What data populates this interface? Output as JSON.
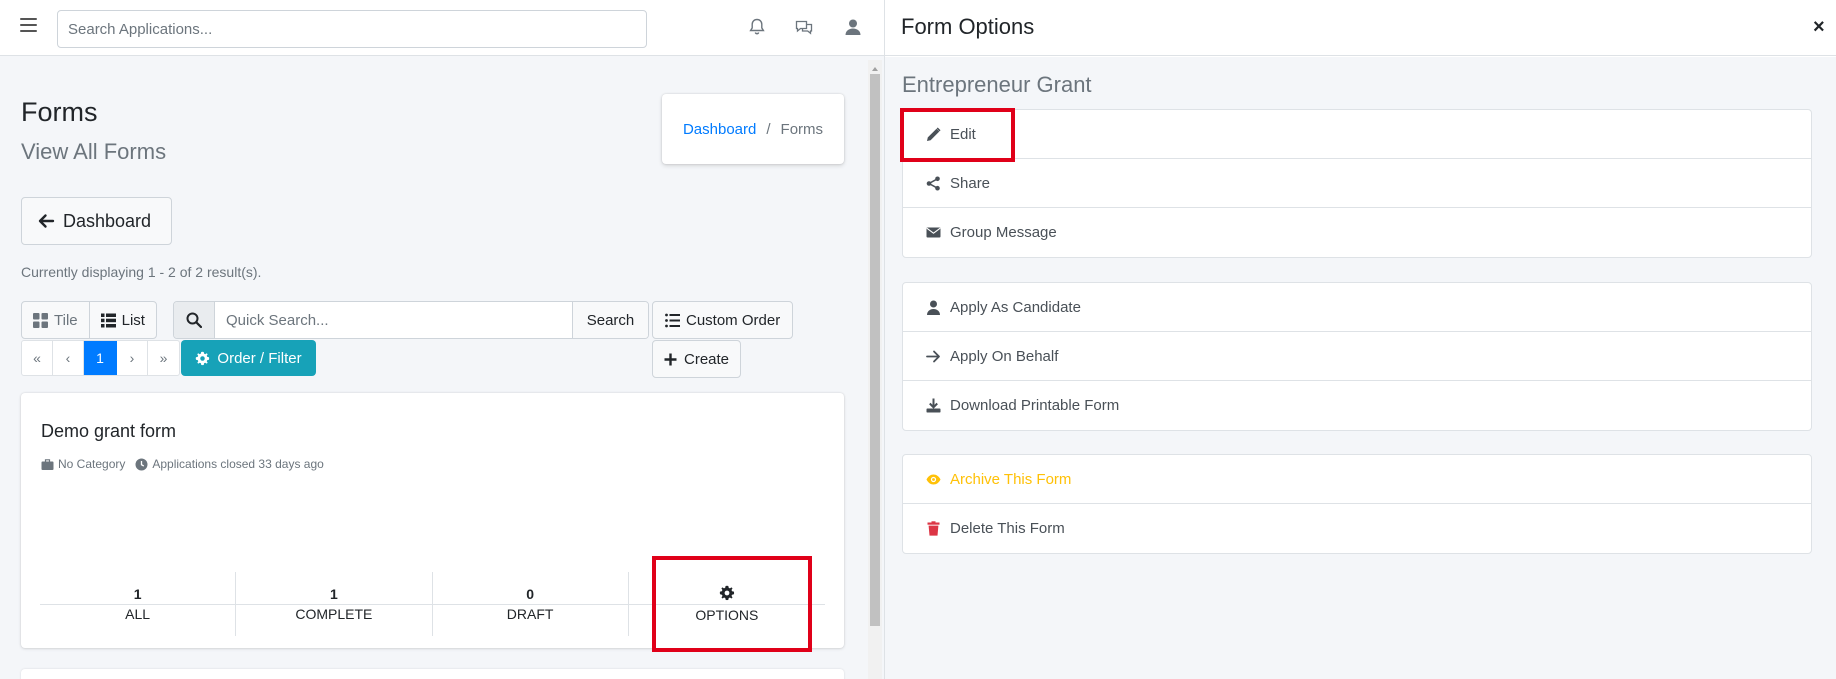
{
  "topbar": {
    "search_placeholder": "Search Applications..."
  },
  "page": {
    "title": "Forms",
    "subtitle": "View All Forms",
    "breadcrumb": {
      "link": "Dashboard",
      "separator": "/",
      "current": "Forms"
    },
    "back_button": "Dashboard",
    "result_text": "Currently displaying 1 - 2 of 2 result(s).",
    "view_toggle": {
      "tile": "Tile",
      "list": "List"
    },
    "quick_search": {
      "placeholder": "Quick Search...",
      "button": "Search"
    },
    "custom_order": "Custom Order",
    "create": "Create",
    "pagination": [
      "«",
      "‹",
      "1",
      "›",
      "»"
    ],
    "order_filter": "Order / Filter"
  },
  "form_card": {
    "title": "Demo grant form",
    "category": "No Category",
    "status": "Applications closed 33 days ago",
    "stats": [
      {
        "num": "1",
        "label": "ALL"
      },
      {
        "num": "1",
        "label": "COMPLETE"
      },
      {
        "num": "0",
        "label": "DRAFT"
      }
    ],
    "options_label": "OPTIONS"
  },
  "panel": {
    "title": "Form Options",
    "close": "×",
    "form_name": "Entrepreneur Grant",
    "group1": [
      "Edit",
      "Share",
      "Group Message"
    ],
    "group2": [
      "Apply As Candidate",
      "Apply On Behalf",
      "Download Printable Form"
    ],
    "group3": [
      "Archive This Form",
      "Delete This Form"
    ]
  },
  "colors": {
    "primary": "#007bff",
    "info": "#17a2b8",
    "warning": "#ffc107",
    "danger": "#dc3545",
    "highlight": "#e00019"
  }
}
